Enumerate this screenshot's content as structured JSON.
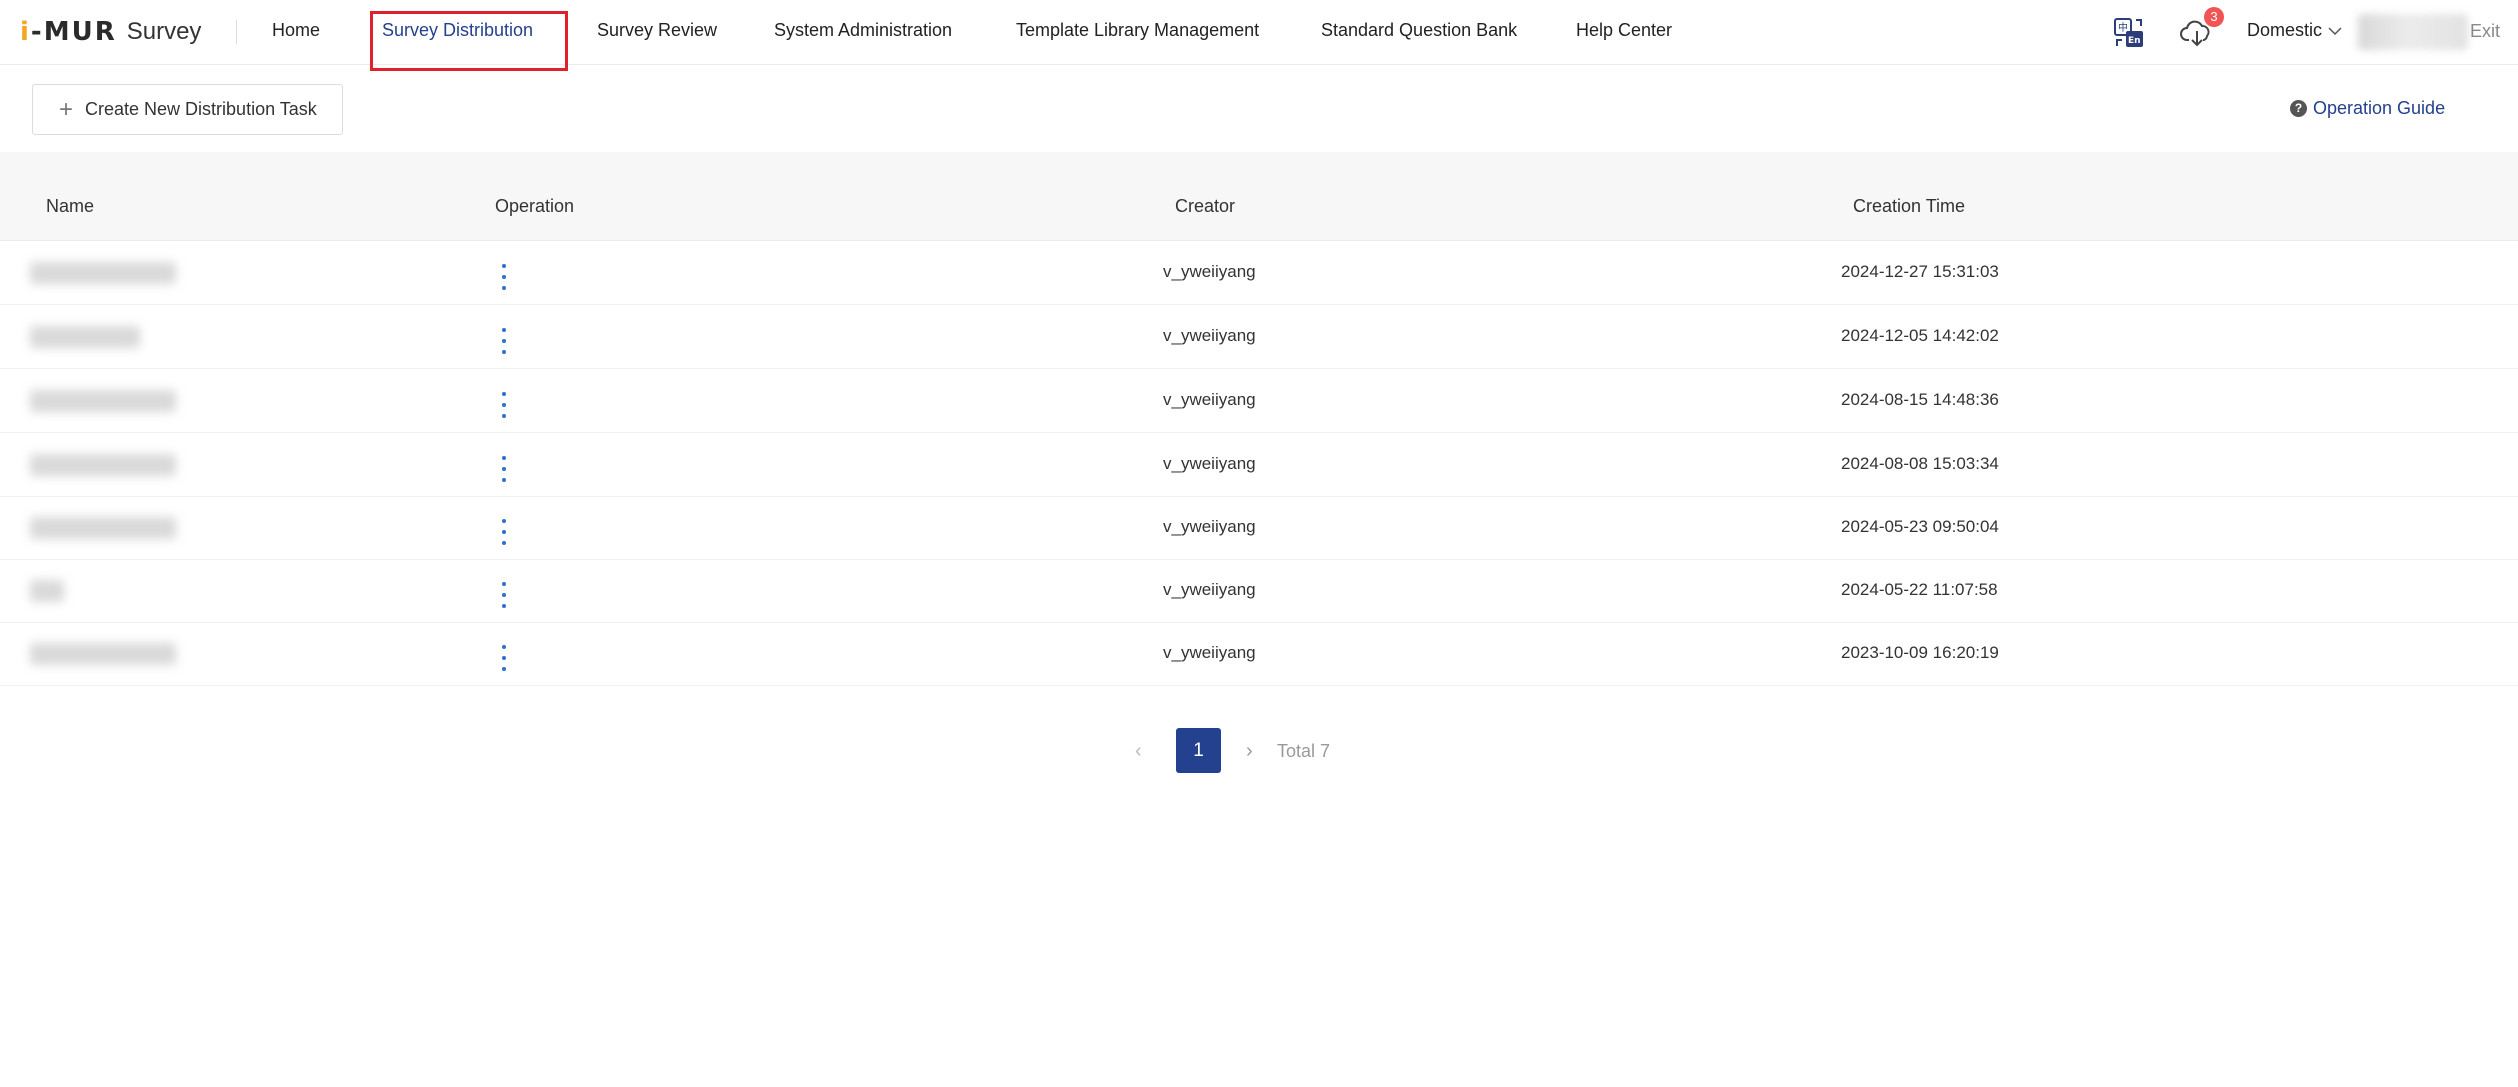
{
  "header": {
    "logo_mark": "i-MUR",
    "logo_text": "Survey",
    "nav": [
      {
        "label": "Home"
      },
      {
        "label": "Survey Distribution"
      },
      {
        "label": "Survey Review"
      },
      {
        "label": "System Administration"
      },
      {
        "label": "Template Library Management"
      },
      {
        "label": "Standard Question Bank"
      },
      {
        "label": "Help Center"
      }
    ],
    "active_nav": "Survey Distribution",
    "download_badge": "3",
    "region": "Domestic",
    "exit_label": "Exit",
    "icons": [
      "language-switch-icon",
      "cloud-download-icon",
      "chevron-down-icon"
    ]
  },
  "toolbar": {
    "create_label": "Create New Distribution Task",
    "guide_label": "Operation Guide"
  },
  "table": {
    "columns": [
      "Name",
      "Operation",
      "Creator",
      "Creation Time"
    ],
    "rows": [
      {
        "creator": "v_yweiiyang",
        "time": "2024-12-27 15:31:03"
      },
      {
        "creator": "v_yweiiyang",
        "time": "2024-12-05 14:42:02"
      },
      {
        "creator": "v_yweiiyang",
        "time": "2024-08-15 14:48:36"
      },
      {
        "creator": "v_yweiiyang",
        "time": "2024-08-08 15:03:34"
      },
      {
        "creator": "v_yweiiyang",
        "time": "2024-05-23 09:50:04"
      },
      {
        "creator": "v_yweiiyang",
        "time": "2024-05-22 11:07:58"
      },
      {
        "creator": "v_yweiiyang",
        "time": "2023-10-09 16:20:19"
      }
    ]
  },
  "pagination": {
    "current_page": "1",
    "total_label": "Total 7"
  },
  "colors": {
    "accent": "#24418f",
    "highlight_box": "#e0202a",
    "badge": "#f05454",
    "operation_dots": "#2f6fd1"
  }
}
